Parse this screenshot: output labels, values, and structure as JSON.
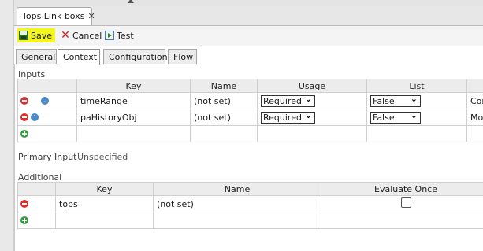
{
  "editor_tab": {
    "title": "Tops Link boxs",
    "close_glyph": "✕"
  },
  "toolbar": {
    "save": "Save",
    "cancel": "Cancel",
    "test": "Test"
  },
  "tabs": [
    "General",
    "Context",
    "Configuration",
    "Flow"
  ],
  "active_tab": "Context",
  "inputs": {
    "label": "Inputs",
    "columns": [
      "Key",
      "Name",
      "Usage",
      "List"
    ],
    "rows": [
      {
        "key": "timeRange",
        "name": "(not set)",
        "usage": "Required",
        "list": "False",
        "extra": "Commo"
      },
      {
        "key": "paHistoryObj",
        "name": "(not set)",
        "usage": "Required",
        "list": "False",
        "extra": "Monitor"
      }
    ]
  },
  "primary_input": {
    "label": "Primary Input",
    "value": "Unspecified"
  },
  "additional": {
    "label": "Additional",
    "columns": [
      "Key",
      "Name",
      "Evaluate Once"
    ],
    "rows": [
      {
        "key": "tops",
        "name": "(not set)",
        "evaluate_once": false
      }
    ]
  },
  "colors": {
    "save_highlight": "#f3f61c",
    "remove": "#d9312c",
    "add": "#2f9e3b",
    "move": "#4a89c8"
  },
  "icons": {
    "save": "save-disk-icon",
    "cancel": "cancel-x-icon",
    "test": "test-run-icon",
    "remove": "remove-row-icon",
    "add": "add-row-icon",
    "move_down": "move-down-icon",
    "move_up": "move-up-icon"
  }
}
